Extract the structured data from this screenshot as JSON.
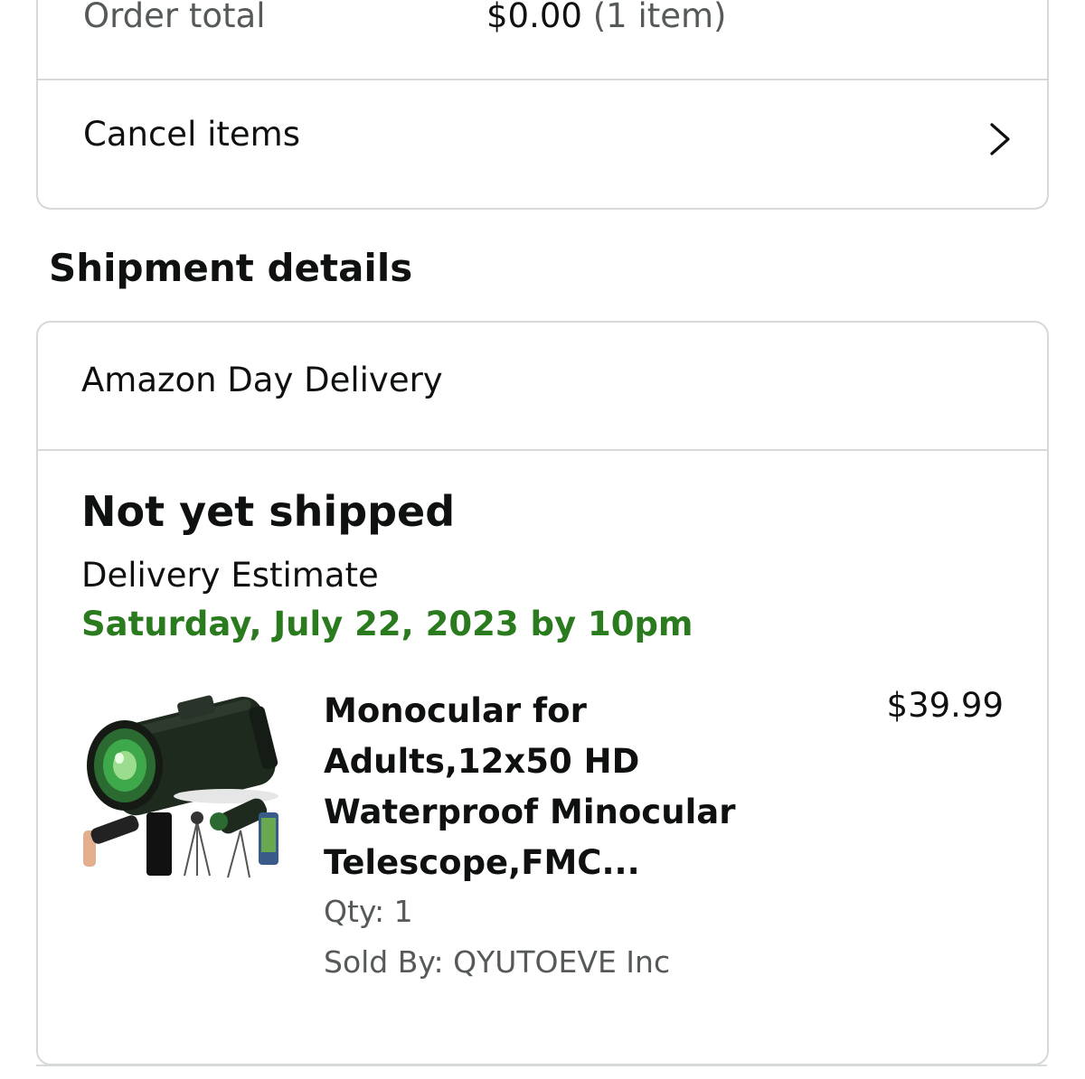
{
  "order_summary": {
    "order_total_label": "Order total",
    "order_total_amount": "$0.00",
    "order_total_count": "(1 item)",
    "cancel_items_label": "Cancel items",
    "chevron_icon": "chevron-right-icon"
  },
  "shipment": {
    "section_title": "Shipment details",
    "delivery_type": "Amazon Day Delivery",
    "status": "Not yet shipped",
    "estimate_label": "Delivery Estimate",
    "estimate_date": "Saturday, July 22, 2023 by 10pm",
    "colors": {
      "estimate_date": "#2a7a1e",
      "border": "#d5d9d9",
      "secondary_text": "#565959"
    }
  },
  "item": {
    "title": "Monocular for Adults,12x50 HD Waterproof Minocular Telescope,FMC...",
    "price": "$39.99",
    "qty": "Qty: 1",
    "sold_by": "Sold By: QYUTOEVE Inc",
    "image_icon": "monocular-product-image"
  }
}
